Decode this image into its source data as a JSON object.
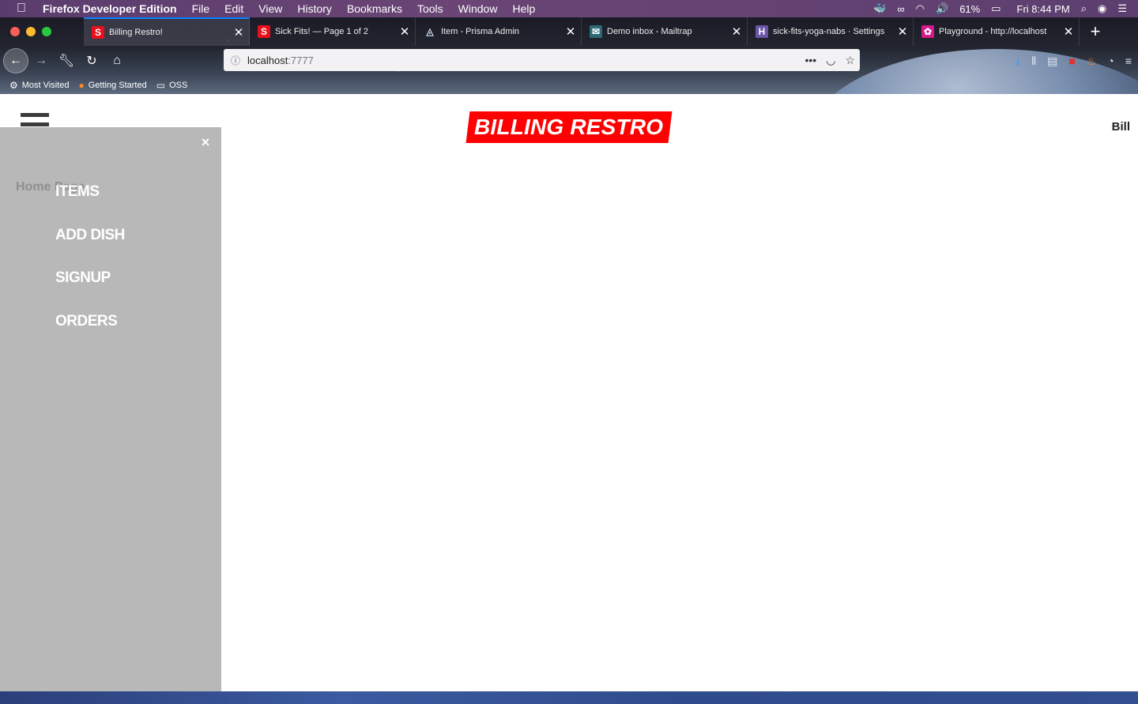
{
  "menubar": {
    "apple": "",
    "items": [
      "Firefox Developer Edition",
      "File",
      "Edit",
      "View",
      "History",
      "Bookmarks",
      "Tools",
      "Window",
      "Help"
    ],
    "battery": "61%",
    "clock": "Fri 8:44 PM"
  },
  "tabs": [
    {
      "favicon": "S",
      "color": "#e8101a",
      "title": "Billing Restro!"
    },
    {
      "favicon": "S",
      "color": "#e8101a",
      "title": "Sick Fits! — Page 1 of 2"
    },
    {
      "favicon": "◬",
      "color": "#1b2b45",
      "title": "Item - Prisma Admin"
    },
    {
      "favicon": "✉",
      "color": "#2b6a77",
      "title": "Demo inbox - Mailtrap"
    },
    {
      "favicon": "H",
      "color": "#6a56a8",
      "title": "sick-fits-yoga-nabs · Settings"
    },
    {
      "favicon": "✿",
      "color": "#d8178c",
      "title": "Playground - http://localhost"
    }
  ],
  "url": {
    "host": "localhost",
    "port": ":7777"
  },
  "bookmarks": [
    {
      "icon": "gear-icon",
      "label": "Most Visited"
    },
    {
      "icon": "firefox-icon",
      "label": "Getting Started"
    },
    {
      "icon": "folder-icon",
      "label": "OSS"
    }
  ],
  "site": {
    "logo": "BILLING RESTRO",
    "nav_right": "Bill",
    "sidebar": {
      "close": "×",
      "home": "Home Page",
      "items": [
        "ITEMS",
        "ADD DISH",
        "SIGNUP",
        "ORDERS"
      ]
    }
  }
}
